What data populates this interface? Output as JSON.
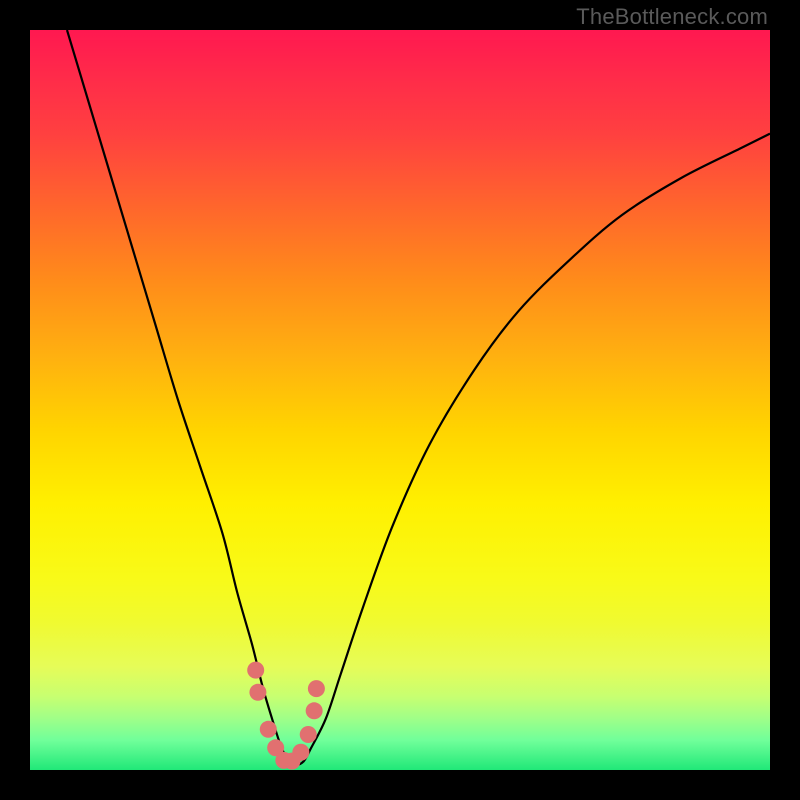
{
  "watermark": "TheBottleneck.com",
  "colors": {
    "frame": "#000000",
    "curve": "#000000",
    "dots": "#e17070"
  },
  "chart_data": {
    "type": "line",
    "title": "",
    "xlabel": "",
    "ylabel": "",
    "xlim": [
      0,
      100
    ],
    "ylim": [
      0,
      100
    ],
    "series": [
      {
        "name": "bottleneck-curve",
        "x": [
          5,
          8,
          11,
          14,
          17,
          20,
          23,
          26,
          28,
          30,
          31.5,
          33,
          34,
          35,
          36,
          37,
          38,
          40,
          42,
          45,
          49,
          54,
          60,
          66,
          73,
          80,
          88,
          96,
          100
        ],
        "y": [
          100,
          90,
          80,
          70,
          60,
          50,
          41,
          32,
          24,
          17,
          11,
          6,
          3,
          1.2,
          0.7,
          1.2,
          3,
          7,
          13,
          22,
          33,
          44,
          54,
          62,
          69,
          75,
          80,
          84,
          86
        ]
      }
    ],
    "scatter": {
      "name": "highlighted-points",
      "x": [
        30.5,
        30.8,
        32.2,
        33.2,
        34.3,
        35.4,
        36.6,
        37.6,
        38.4,
        38.7
      ],
      "y": [
        13.5,
        10.5,
        5.5,
        3.0,
        1.3,
        1.2,
        2.4,
        4.8,
        8.0,
        11.0
      ]
    },
    "background_gradient": {
      "top": "#ff1850",
      "middle": "#fff000",
      "bottom": "#20e878"
    }
  }
}
